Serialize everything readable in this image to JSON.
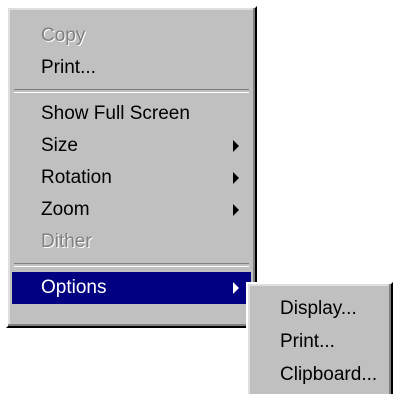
{
  "main_menu": {
    "copy": "Copy",
    "print": "Print...",
    "show_full_screen": "Show Full Screen",
    "size": "Size",
    "rotation": "Rotation",
    "zoom": "Zoom",
    "dither": "Dither",
    "options": "Options"
  },
  "submenu": {
    "display": "Display...",
    "print": "Print...",
    "clipboard": "Clipboard..."
  },
  "colors": {
    "menu_background": "#c0c0c0",
    "highlight": "#000080",
    "disabled_text": "#808080"
  },
  "icons": {
    "submenu_arrow": "submenu-arrow-icon"
  }
}
